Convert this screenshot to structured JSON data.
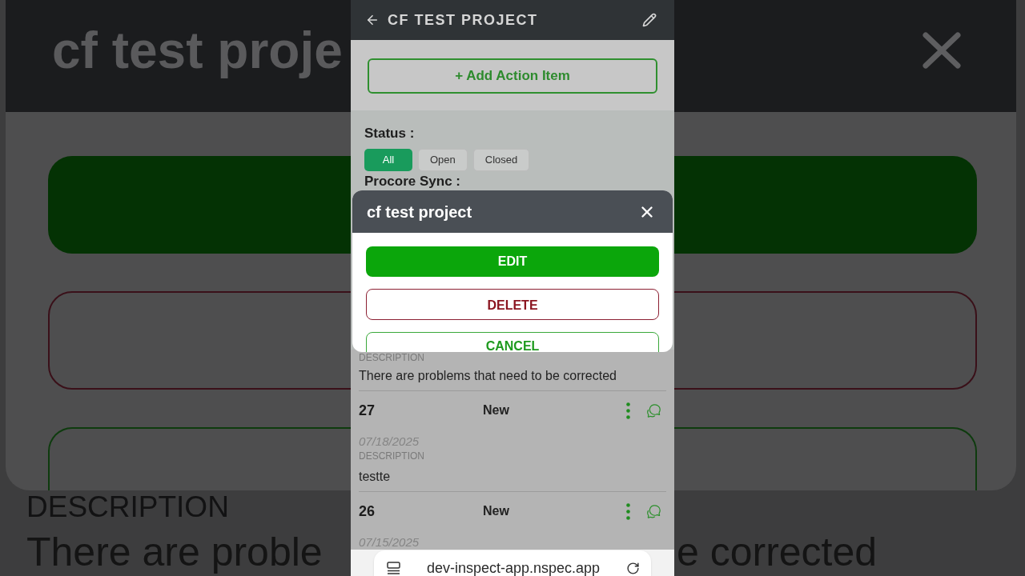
{
  "backdrop": {
    "title": "cf test proje",
    "label": "DESCRIPTION",
    "text_left": "There are proble",
    "text_right": "e corrected"
  },
  "header": {
    "title": "CF TEST PROJECT"
  },
  "add_button": {
    "label": "+ Add Action Item"
  },
  "filters": {
    "status_label": "Status :",
    "status_options": [
      {
        "label": "All",
        "selected": true
      },
      {
        "label": "Open",
        "selected": false
      },
      {
        "label": "Closed",
        "selected": false
      }
    ],
    "sync_label": "Procore Sync :"
  },
  "list": {
    "items": [
      {
        "description_label": "DESCRIPTION",
        "description": "There are problems that need to be corrected"
      },
      {
        "number": "27",
        "status": "New",
        "date": "07/18/2025",
        "description_label": "DESCRIPTION",
        "description": "testte"
      },
      {
        "number": "26",
        "status": "New",
        "date": "07/15/2025"
      }
    ]
  },
  "modal": {
    "title": "cf test project",
    "buttons": [
      {
        "label": "EDIT",
        "kind": "primary"
      },
      {
        "label": "DELETE",
        "kind": "danger"
      },
      {
        "label": "CANCEL",
        "kind": "secondary"
      }
    ]
  },
  "browser_bar": {
    "url": "dev-inspect-app.nspec.app"
  }
}
